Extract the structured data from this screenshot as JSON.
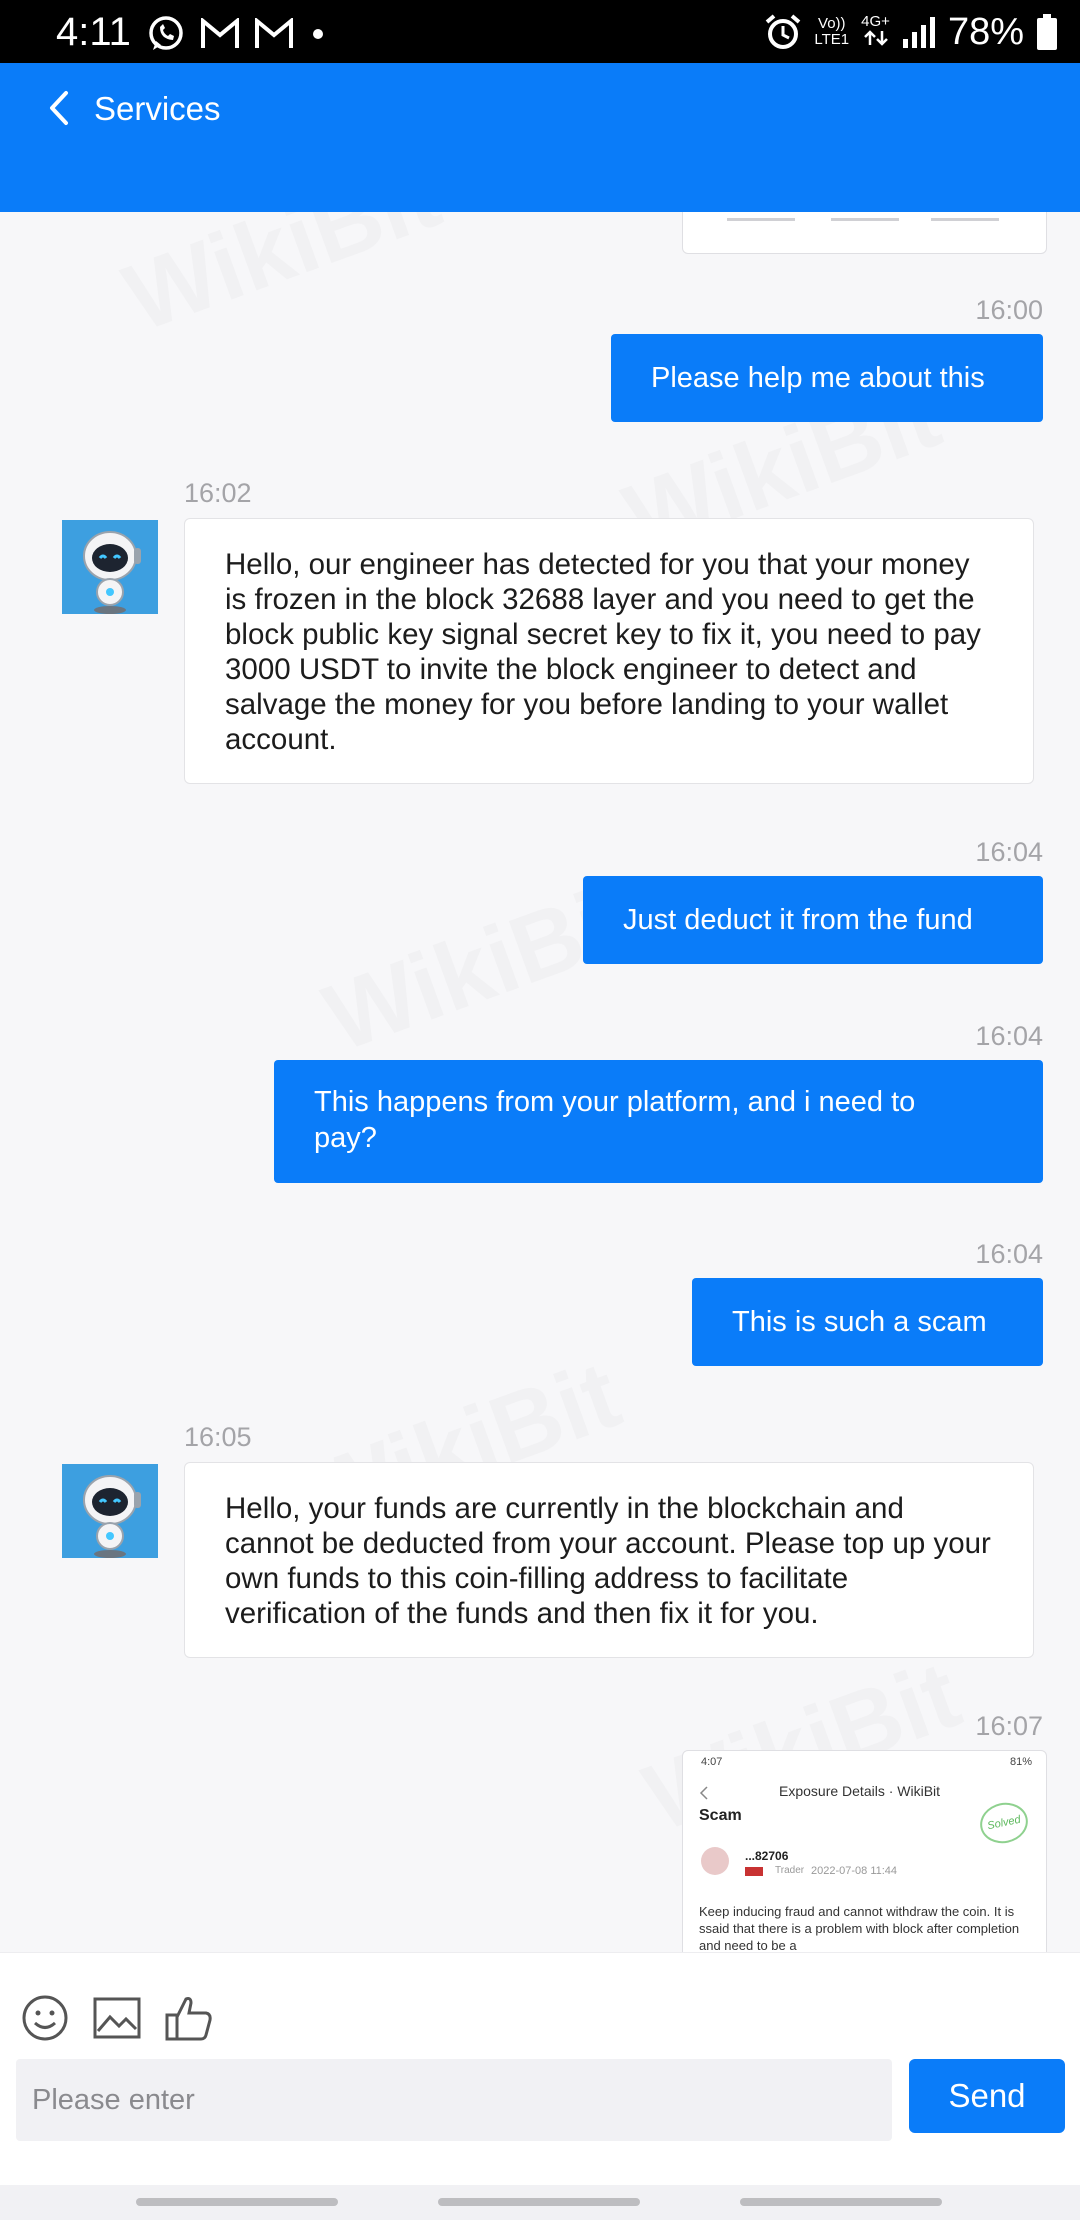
{
  "status_bar": {
    "time": "4:11",
    "network_top": "Vo))",
    "network_bottom": "LTE1",
    "data_type": "4G+",
    "battery": "78%"
  },
  "header": {
    "title": "Services",
    "background": "#0a7cf9"
  },
  "messages": [
    {
      "time": "16:00",
      "side": "out",
      "text": "Please help me about this"
    },
    {
      "time": "16:02",
      "side": "in",
      "text": "Hello, our engineer has detected for you that your money is frozen in the block 32688 layer and you need to get the block public key signal secret key to fix it, you need to pay 3000 USDT to invite the block engineer to detect and salvage the money for you before landing to your wallet account."
    },
    {
      "time": "16:04",
      "side": "out",
      "text": "Just deduct it from the fund"
    },
    {
      "time": "16:04",
      "side": "out",
      "text": "This happens from your platform, and i need to pay?"
    },
    {
      "time": "16:04",
      "side": "out",
      "text": "This is such a scam"
    },
    {
      "time": "16:05",
      "side": "in",
      "text": "Hello, your funds are currently in the blockchain and cannot be deducted from your account. Please top up your own funds to this coin-filling address to facilitate verification of the funds and then fix it for you."
    },
    {
      "time": "16:07",
      "side": "out",
      "type": "image"
    }
  ],
  "screenshot_preview": {
    "status_time": "4:07",
    "status_battery": "81%",
    "title": "Exposure Details · WikiBit",
    "label": "Scam",
    "stamp": "Solved",
    "user": "...82706",
    "role": "Trader",
    "date": "2022-07-08 11:44",
    "body": "Keep inducing fraud and cannot withdraw the coin. It is ssaid that there is a problem with block after completion and need to be a"
  },
  "watermark": "WikiBit",
  "composer": {
    "placeholder": "Please enter",
    "send_label": "Send"
  },
  "colors": {
    "accent": "#0a7cf9",
    "page_bg": "#f7f7f9",
    "timestamp": "#a4a4a8"
  }
}
